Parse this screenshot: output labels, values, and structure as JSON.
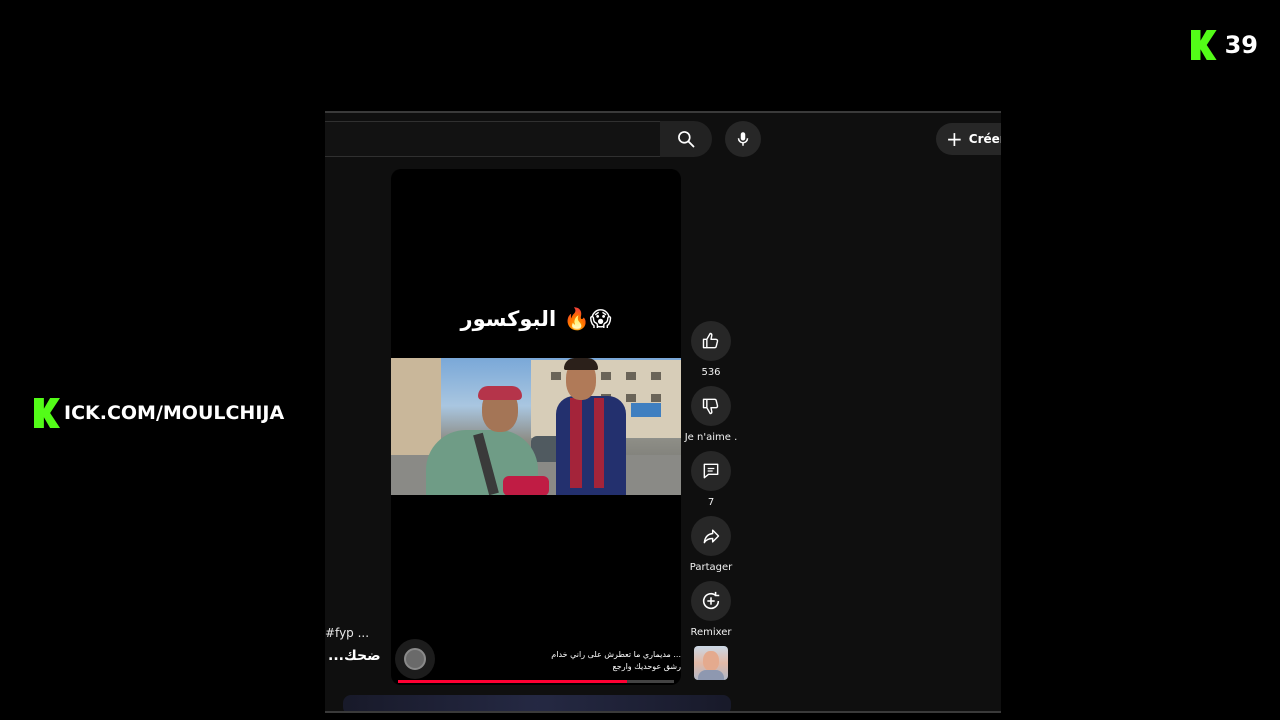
{
  "overlay": {
    "viewer_count": "39",
    "logo_icon": "kick-logo-icon",
    "kick_url": "ICK.COM/MOULCHIJA",
    "brand_color": "#53fc18"
  },
  "header": {
    "search_icon": "search-icon",
    "mic_icon": "mic-icon",
    "create_label": "Créer"
  },
  "short": {
    "title": "البوكسور 🔥😱",
    "caption_line1": "... مديماري ما تعطرش على راني خدام",
    "caption_line2": "رشق عوحديك وارجع",
    "progress": 0.83,
    "progress_color": "#ff0033"
  },
  "actions": [
    {
      "icon": "thumbs-up-icon",
      "label": "536"
    },
    {
      "icon": "thumbs-down-icon",
      "label": "Je n'aime ."
    },
    {
      "icon": "comment-icon",
      "label": "7"
    },
    {
      "icon": "share-icon",
      "label": "Partager"
    },
    {
      "icon": "remix-icon",
      "label": "Remixer"
    }
  ],
  "left_panel": {
    "tag": "#fyp ...",
    "title": "ضحك..."
  }
}
